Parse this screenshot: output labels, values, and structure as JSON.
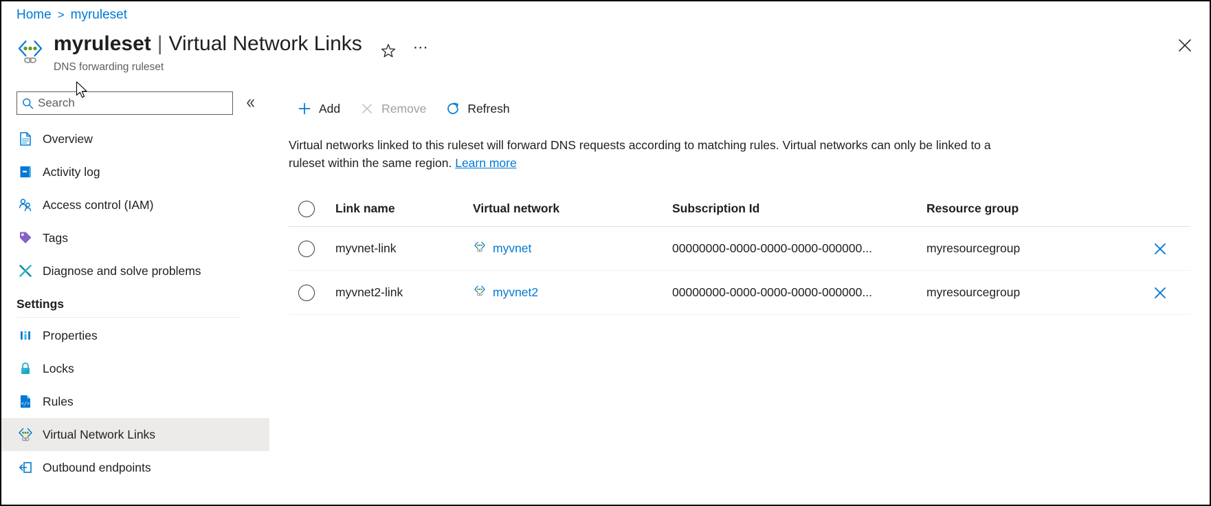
{
  "breadcrumb": {
    "items": [
      {
        "label": "Home",
        "icon": ""
      },
      {
        "label": "myruleset",
        "icon": ""
      }
    ],
    "separator": ">"
  },
  "header": {
    "resource_icon": "dns-forwarding-ruleset-icon",
    "title_resource": "myruleset",
    "title_separator": "|",
    "title_section": "Virtual Network Links",
    "subtitle": "DNS forwarding ruleset",
    "favorite_icon": "star-outline-icon",
    "more_icon": "ellipsis-icon",
    "close_icon": "close-icon"
  },
  "sidebar": {
    "search": {
      "placeholder": "Search",
      "value": "",
      "icon": "search-icon"
    },
    "collapse_icon": "chevron-double-left-icon",
    "items": [
      {
        "label": "Overview",
        "icon": "overview-document-icon",
        "selected": false
      },
      {
        "label": "Activity log",
        "icon": "activity-log-icon",
        "selected": false
      },
      {
        "label": "Access control (IAM)",
        "icon": "access-control-people-icon",
        "selected": false
      },
      {
        "label": "Tags",
        "icon": "tag-icon",
        "selected": false
      },
      {
        "label": "Diagnose and solve problems",
        "icon": "wrench-screwdriver-icon",
        "selected": false
      }
    ],
    "group_label": "Settings",
    "settings_items": [
      {
        "label": "Properties",
        "icon": "properties-bars-icon",
        "selected": false
      },
      {
        "label": "Locks",
        "icon": "lock-icon",
        "selected": false
      },
      {
        "label": "Rules",
        "icon": "rules-code-file-icon",
        "selected": false
      },
      {
        "label": "Virtual Network Links",
        "icon": "virtual-network-link-icon",
        "selected": true
      },
      {
        "label": "Outbound endpoints",
        "icon": "outbound-endpoint-icon",
        "selected": false
      }
    ]
  },
  "toolbar": {
    "add": {
      "label": "Add",
      "icon": "plus-icon",
      "disabled": false
    },
    "remove": {
      "label": "Remove",
      "icon": "cross-icon",
      "disabled": true
    },
    "refresh": {
      "label": "Refresh",
      "icon": "refresh-icon",
      "disabled": false
    }
  },
  "description": {
    "text": "Virtual networks linked to this ruleset will forward DNS requests according to matching rules. Virtual networks can only be linked to a ruleset within the same region.",
    "link_label": "Learn more"
  },
  "table": {
    "select_all_control": "radio",
    "columns": [
      "Link name",
      "Virtual network",
      "Subscription Id",
      "Resource group"
    ],
    "rows": [
      {
        "selected": false,
        "link_name": "myvnet-link",
        "virtual_network": "myvnet",
        "virtual_network_icon": "virtual-network-icon",
        "subscription_id": "00000000-0000-0000-0000-000000...",
        "resource_group": "myresourcegroup",
        "delete_icon": "close-icon"
      },
      {
        "selected": false,
        "link_name": "myvnet2-link",
        "virtual_network": "myvnet2",
        "virtual_network_icon": "virtual-network-icon",
        "subscription_id": "00000000-0000-0000-0000-000000...",
        "resource_group": "myresourcegroup",
        "delete_icon": "close-icon"
      }
    ]
  },
  "colors": {
    "accent": "#0078d4",
    "link": "#0078d4",
    "text": "#201f1e",
    "muted": "#605e5c",
    "disabled": "#a19f9d",
    "selected_row_bg": "#edebe9",
    "divider": "#e1dfdd",
    "icon_green": "#5e9a29",
    "icon_purple": "#8661c5",
    "icon_teal": "#0f8ea5",
    "icon_gold": "#ffb900"
  }
}
